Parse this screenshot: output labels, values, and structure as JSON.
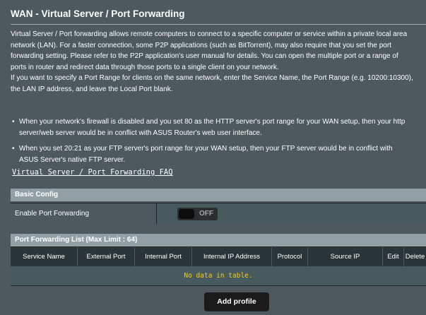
{
  "page": {
    "title": "WAN - Virtual Server / Port Forwarding"
  },
  "description": {
    "lines": [
      "Virtual Server / Port forwarding allows remote computers to connect to a specific computer or service within a private local area",
      "network (LAN). For a faster connection, some P2P applications (such as BitTorrent), may also require that you set the port",
      "forwarding setting. Please refer to the P2P application's user manual for details. You can open the multiple port or a range of",
      "ports in router and redirect data through those ports to a single client on your network.",
      "If you want to specify a Port Range for clients on the same network, enter the Service Name, the Port Range (e.g. 10200:10300),",
      "the LAN IP address, and leave the Local Port blank."
    ]
  },
  "bullets": [
    {
      "lines": [
        "When your network's firewall is disabled and you set 80 as the HTTP server's port range for your WAN setup, then your http",
        "server/web server would be in conflict with ASUS Router's web user interface."
      ]
    },
    {
      "lines": [
        "When you set 20:21 as your FTP server's port range for your WAN setup, then your FTP server would be in conflict with",
        "ASUS Server's native FTP server."
      ]
    }
  ],
  "faq_link": "Virtual Server / Port Forwarding FAQ",
  "basic_config": {
    "header": "Basic Config",
    "enable_label": "Enable Port Forwarding",
    "toggle_state": "OFF"
  },
  "port_list": {
    "header": "Port Forwarding List (Max Limit : 64)",
    "columns": [
      "Service Name",
      "External Port",
      "Internal Port",
      "Internal IP Address",
      "Protocol",
      "Source IP",
      "Edit",
      "Delete"
    ],
    "empty_text": "No data in table."
  },
  "add_profile_label": "Add profile",
  "colors": {
    "background": "#4d595d",
    "header_bar": "#92a0a5",
    "table_header": "#2b3538",
    "empty_text": "#ffcc00"
  }
}
